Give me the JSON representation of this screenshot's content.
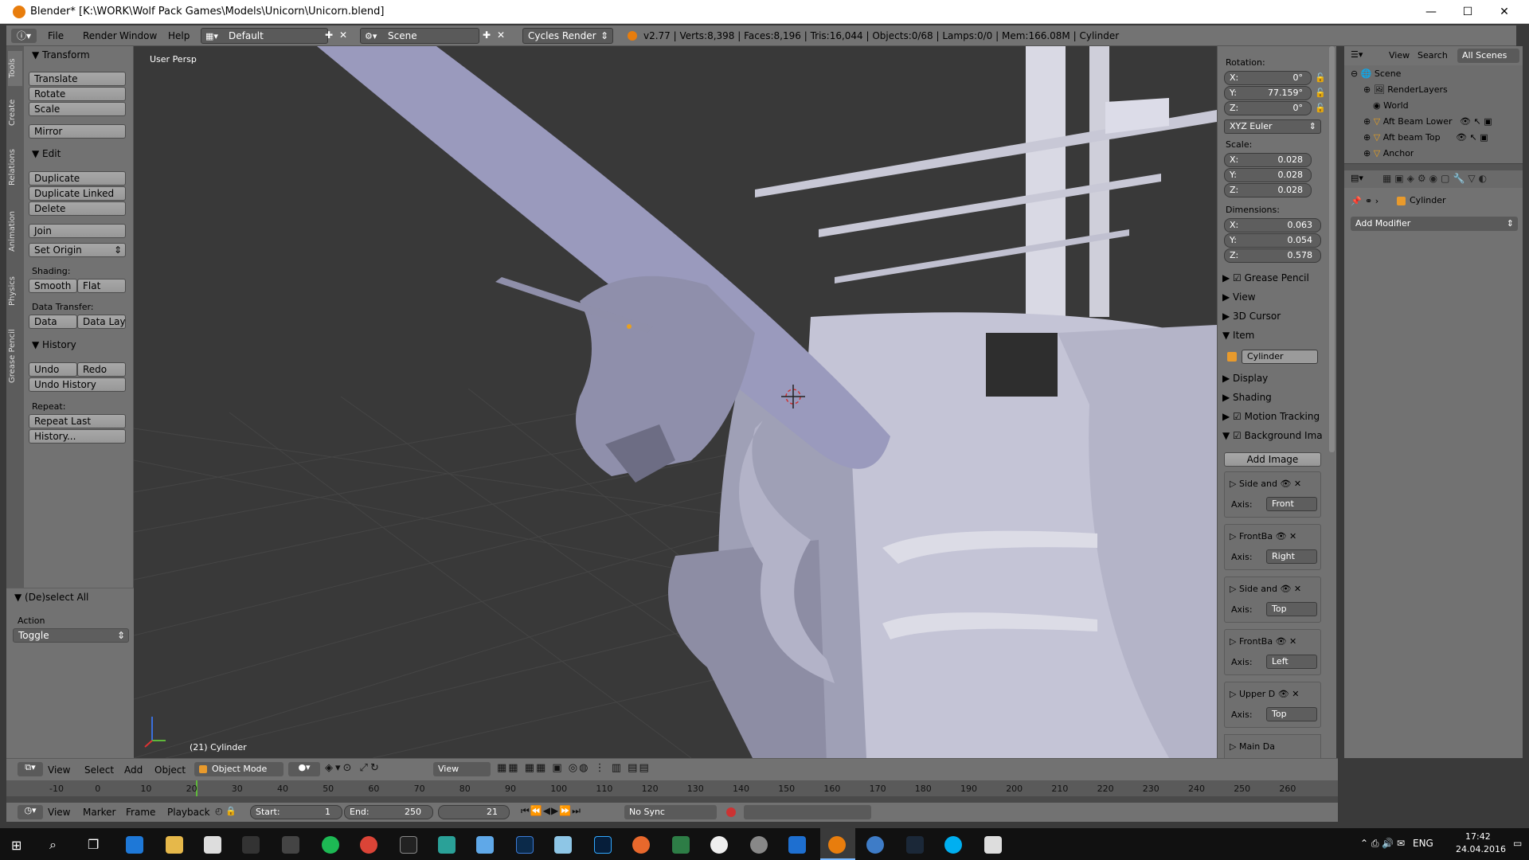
{
  "window": {
    "title": "Blender* [K:\\WORK\\Wolf Pack Games\\Models\\Unicorn\\Unicorn.blend]",
    "minimize": "—",
    "maximize": "☐",
    "close": "✕"
  },
  "infobar": {
    "menus": [
      "File",
      "Render",
      "Window",
      "Help"
    ],
    "layout": "Default",
    "scene": "Scene",
    "engine": "Cycles Render",
    "stats": "v2.77 | Verts:8,398 | Faces:8,196 | Tris:16,044 | Objects:0/68 | Lamps:0/0 | Mem:166.08M | Cylinder"
  },
  "tabs": [
    "Tools",
    "Create",
    "Relations",
    "Animation",
    "Physics",
    "Grease Pencil"
  ],
  "toolshelf": {
    "transform_header": "Transform",
    "translate": "Translate",
    "rotate": "Rotate",
    "scale": "Scale",
    "mirror": "Mirror",
    "edit_header": "Edit",
    "duplicate": "Duplicate",
    "duplicate_linked": "Duplicate Linked",
    "delete": "Delete",
    "join": "Join",
    "set_origin": "Set Origin",
    "shading_label": "Shading:",
    "smooth": "Smooth",
    "flat": "Flat",
    "data_transfer_label": "Data Transfer:",
    "data": "Data",
    "data_layo": "Data Layo",
    "history_header": "History",
    "undo": "Undo",
    "redo": "Redo",
    "undo_history": "Undo History",
    "repeat_label": "Repeat:",
    "repeat_last": "Repeat Last",
    "history_btn": "History...",
    "operator_header": "(De)select All",
    "action_label": "Action",
    "action_value": "Toggle"
  },
  "viewport": {
    "view_name": "User Persp",
    "object_label": "(21) Cylinder"
  },
  "properties": {
    "rotation_label": "Rotation:",
    "rot_x": "X:",
    "rot_x_val": "0°",
    "rot_y": "Y:",
    "rot_y_val": "77.159°",
    "rot_z": "Z:",
    "rot_z_val": "0°",
    "rot_mode": "XYZ Euler",
    "scale_label": "Scale:",
    "sc_x": "X:",
    "sc_x_val": "0.028",
    "sc_y": "Y:",
    "sc_y_val": "0.028",
    "sc_z": "Z:",
    "sc_z_val": "0.028",
    "dim_label": "Dimensions:",
    "dim_x": "X:",
    "dim_x_val": "0.063",
    "dim_y": "Y:",
    "dim_y_val": "0.054",
    "dim_z": "Z:",
    "dim_z_val": "0.578",
    "panels": [
      "Grease Pencil",
      "View",
      "3D Cursor"
    ],
    "item_header": "Item",
    "item_name": "Cylinder",
    "panels2": [
      "Display",
      "Shading",
      "Motion Tracking"
    ],
    "bg_header": "Background Ima",
    "add_image": "Add Image",
    "axis_label": "Axis:",
    "bg_images": [
      {
        "name": "Side and",
        "axis": "Front"
      },
      {
        "name": "FrontBa",
        "axis": "Right"
      },
      {
        "name": "Side and",
        "axis": "Top"
      },
      {
        "name": "FrontBa",
        "axis": "Left"
      },
      {
        "name": "Upper D",
        "axis": "Top"
      }
    ],
    "last_partial": "Main Da"
  },
  "outliner": {
    "view": "View",
    "search": "Search",
    "filter": "All Scenes",
    "rows": [
      "Scene",
      "RenderLayers",
      "World",
      "Aft Beam Lower",
      "Aft beam Top",
      "Anchor"
    ]
  },
  "modifiers": {
    "object_name": "Cylinder",
    "add_modifier": "Add Modifier"
  },
  "vpheader": {
    "menus": [
      "View",
      "Select",
      "Add",
      "Object"
    ],
    "mode": "Object Mode",
    "orientation": "View"
  },
  "timeline": {
    "ticks": [
      "-10",
      "0",
      "10",
      "20",
      "30",
      "40",
      "50",
      "60",
      "70",
      "80",
      "90",
      "100",
      "110",
      "120",
      "130",
      "140",
      "150",
      "160",
      "170",
      "180",
      "190",
      "200",
      "210",
      "220",
      "230",
      "240",
      "250",
      "260"
    ],
    "menus": [
      "View",
      "Marker",
      "Frame",
      "Playback"
    ],
    "start_label": "Start:",
    "start": "1",
    "end_label": "End:",
    "end": "250",
    "current": "21",
    "sync": "No Sync"
  },
  "taskbar": {
    "lang": "ENG",
    "time": "17:42",
    "date": "24.04.2016"
  },
  "colors": {
    "blender_orange": "#e87d0d",
    "panel_grey": "#727272",
    "viewport_bg": "#393939",
    "model": "#a9a9c6"
  }
}
